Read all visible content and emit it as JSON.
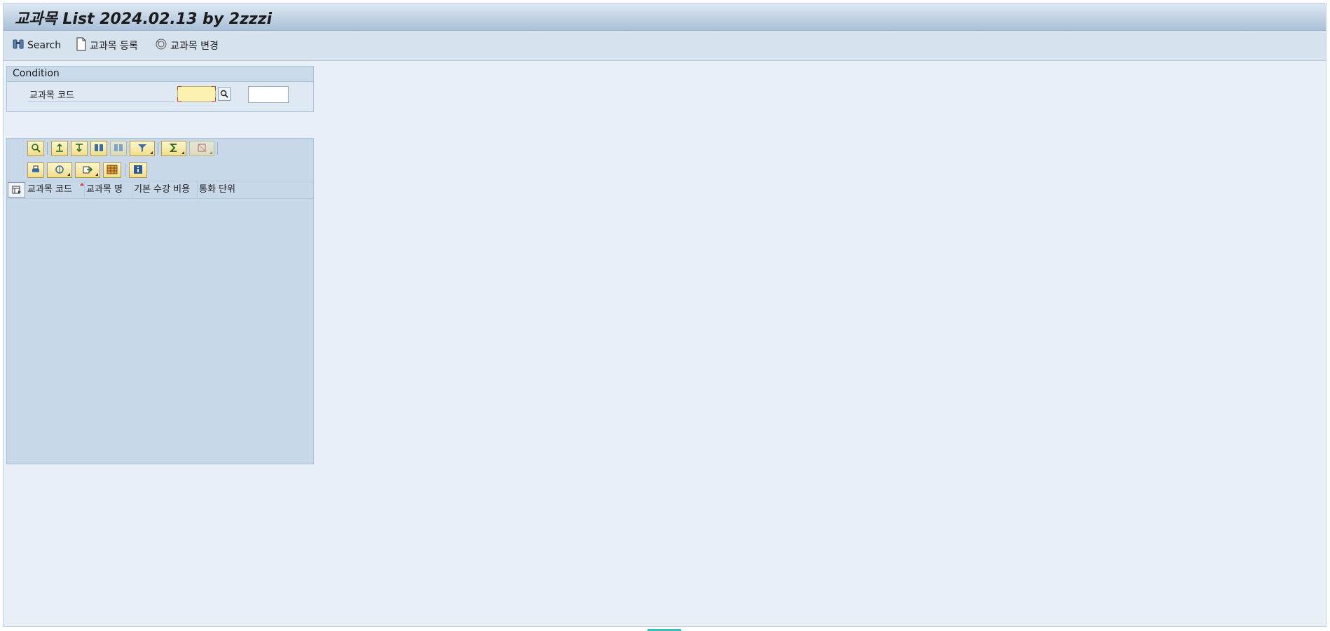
{
  "window": {
    "title": "교과목 List 2024.02.13 by 2zzzi"
  },
  "toolbar": {
    "search_label": "Search",
    "register_label": "교과목 등록",
    "change_label": "교과목 변경"
  },
  "condition": {
    "header": "Condition",
    "field_label": "교과목 코드",
    "from_value": "",
    "to_value": ""
  },
  "grid": {
    "columns": [
      "교과목 코드",
      "교과목 명",
      "기본 수강 비용",
      "통화 단위"
    ],
    "sorted_column": "교과목 코드",
    "rows": []
  },
  "alv_toolbar": {
    "icons": [
      "details-icon",
      "sort-ascending-icon",
      "sort-descending-icon",
      "find-icon",
      "find-next-icon",
      "filter-icon",
      "sum-icon",
      "subtotal-icon",
      "print-icon",
      "views-icon",
      "export-icon",
      "layout-icon",
      "info-icon"
    ]
  },
  "colors": {
    "title_gradient_top": "#dfe8f2",
    "background": "#e8eff7",
    "required_field": "#fdf1b0"
  }
}
